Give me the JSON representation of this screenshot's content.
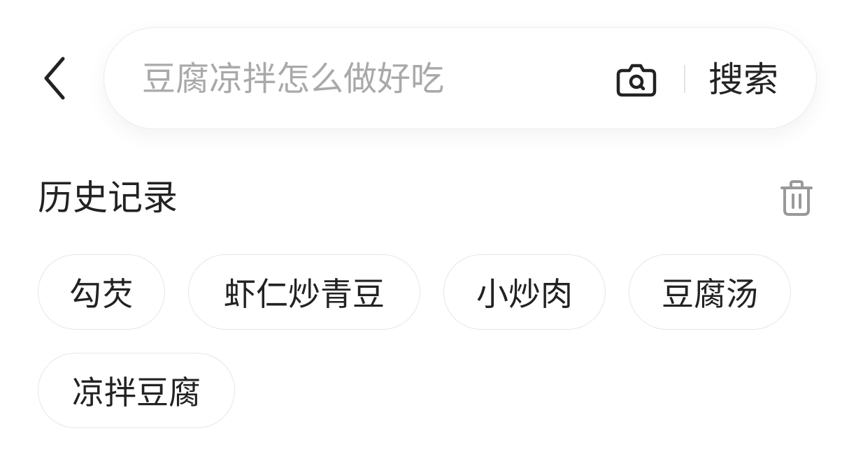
{
  "header": {
    "back_icon": "chevron-left-icon",
    "search": {
      "value": "",
      "placeholder": "豆腐凉拌怎么做好吃",
      "camera_icon": "camera-icon",
      "button_label": "搜索"
    }
  },
  "history": {
    "title": "历史记录",
    "clear_icon": "trash-icon",
    "items": [
      {
        "label": "勾芡"
      },
      {
        "label": "虾仁炒青豆"
      },
      {
        "label": "小炒肉"
      },
      {
        "label": "豆腐汤"
      },
      {
        "label": "凉拌豆腐"
      }
    ]
  },
  "colors": {
    "text": "#222222",
    "placeholder": "#a9a9a9",
    "border": "#e6e6e6",
    "icon_gray": "#999999"
  }
}
